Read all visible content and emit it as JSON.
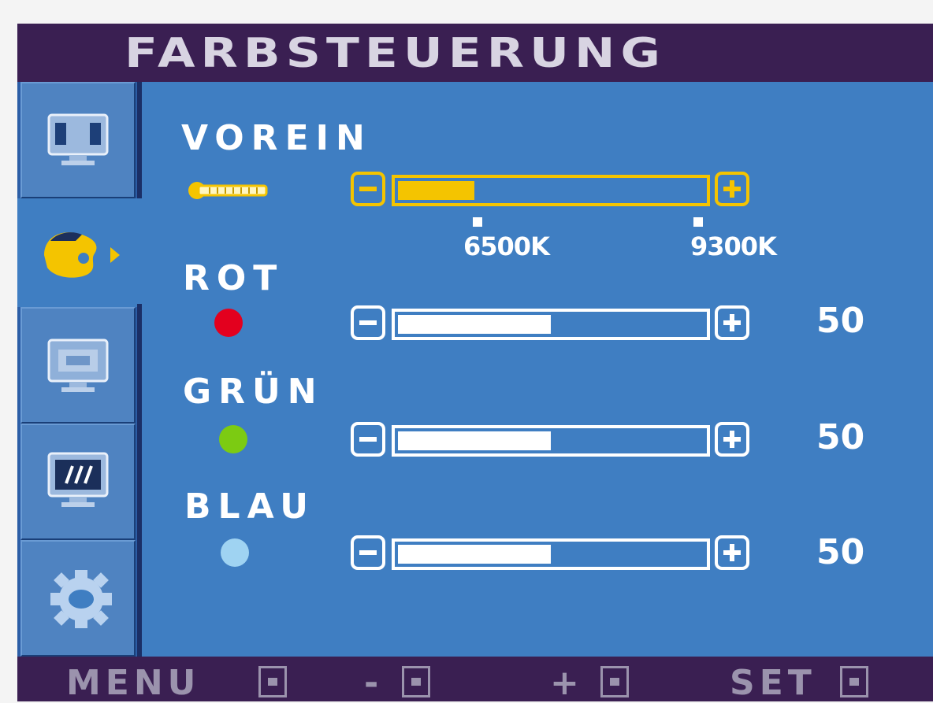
{
  "title": "FARBSTEUERUNG",
  "sidebar": {
    "items": [
      {
        "icon": "picture-icon"
      },
      {
        "icon": "color-palette-icon",
        "active": true
      },
      {
        "icon": "position-icon"
      },
      {
        "icon": "tracking-icon"
      },
      {
        "icon": "setup-gear-icon"
      }
    ]
  },
  "preset": {
    "label": "VOREIN",
    "icon": "thermometer-icon",
    "level": 0.25,
    "options": [
      "6500K",
      "9300K"
    ]
  },
  "channels": [
    {
      "label": "ROT",
      "color": "#e3001e",
      "value": "50",
      "level": 0.5
    },
    {
      "label": "GRÜN",
      "color": "#7ccb12",
      "value": "50",
      "level": 0.5
    },
    {
      "label": "BLAU",
      "color": "#9fd3f2",
      "value": "50",
      "level": 0.5
    }
  ],
  "footer": {
    "menu": "MENU",
    "minus": "-",
    "plus": "+",
    "set": "SET"
  },
  "colors": {
    "background": "#3f7ec2",
    "titlebar": "#3a1f52",
    "accent": "#f4c400"
  }
}
